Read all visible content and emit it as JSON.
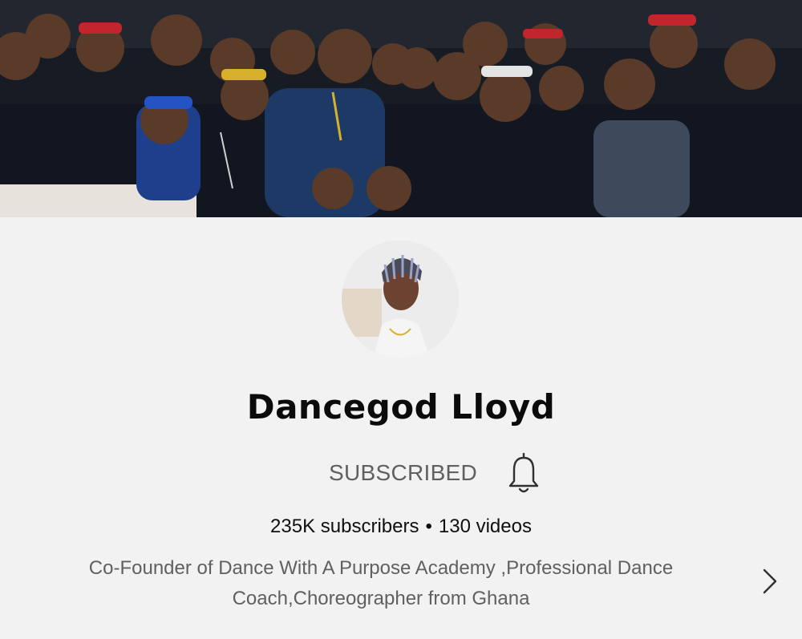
{
  "channel": {
    "name": "Dancegod Lloyd",
    "subscribe_label": "SUBSCRIBED",
    "subscribers": "235K subscribers",
    "separator": "•",
    "videos": "130 videos",
    "description": "Co-Founder of Dance With A Purpose Academy ,Professional Dance Coach,Choreographer from Ghana"
  },
  "icons": {
    "bell": "bell-icon",
    "expand": "chevron-right-icon"
  },
  "colors": {
    "background": "#f2f2f2",
    "title": "#0b0b0b",
    "secondary_text": "#606060"
  }
}
